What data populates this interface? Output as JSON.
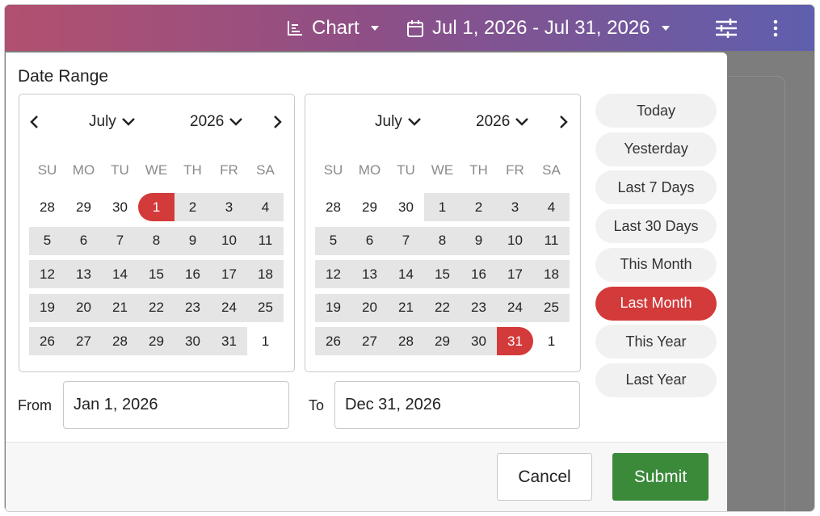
{
  "colors": {
    "accent": "#d33a3a",
    "submit": "#3a8a3a",
    "range_fill": "#e5e5e5"
  },
  "toolbar": {
    "chart_label": "Chart",
    "chart_icon": "bar-chart-icon",
    "date_range_label": "Jul 1, 2026 - Jul 31, 2026",
    "calendar_icon": "calendar-icon",
    "filter_icon": "sliders-icon",
    "menu_icon": "kebab-menu-icon"
  },
  "modal": {
    "title": "Date Range",
    "weekday_headers": [
      "SU",
      "MO",
      "TU",
      "WE",
      "TH",
      "FR",
      "SA"
    ],
    "left_calendar": {
      "month": "July",
      "year": "2026",
      "weeks": [
        [
          "28",
          "29",
          "30",
          "1",
          "2",
          "3",
          "4"
        ],
        [
          "5",
          "6",
          "7",
          "8",
          "9",
          "10",
          "11"
        ],
        [
          "12",
          "13",
          "14",
          "15",
          "16",
          "17",
          "18"
        ],
        [
          "19",
          "20",
          "21",
          "22",
          "23",
          "24",
          "25"
        ],
        [
          "26",
          "27",
          "28",
          "29",
          "30",
          "31",
          "1"
        ]
      ]
    },
    "right_calendar": {
      "month": "July",
      "year": "2026",
      "weeks": [
        [
          "28",
          "29",
          "30",
          "1",
          "2",
          "3",
          "4"
        ],
        [
          "5",
          "6",
          "7",
          "8",
          "9",
          "10",
          "11"
        ],
        [
          "12",
          "13",
          "14",
          "15",
          "16",
          "17",
          "18"
        ],
        [
          "19",
          "20",
          "21",
          "22",
          "23",
          "24",
          "25"
        ],
        [
          "26",
          "27",
          "28",
          "29",
          "30",
          "31",
          "1"
        ]
      ]
    },
    "presets": [
      "Today",
      "Yesterday",
      "Last 7 Days",
      "Last 30 Days",
      "This Month",
      "Last Month",
      "This Year",
      "Last Year"
    ],
    "active_preset": "Last Month",
    "from_label": "From",
    "from_value": "Jan 1, 2026",
    "to_label": "To",
    "to_value": "Dec 31, 2026",
    "cancel_label": "Cancel",
    "submit_label": "Submit"
  }
}
